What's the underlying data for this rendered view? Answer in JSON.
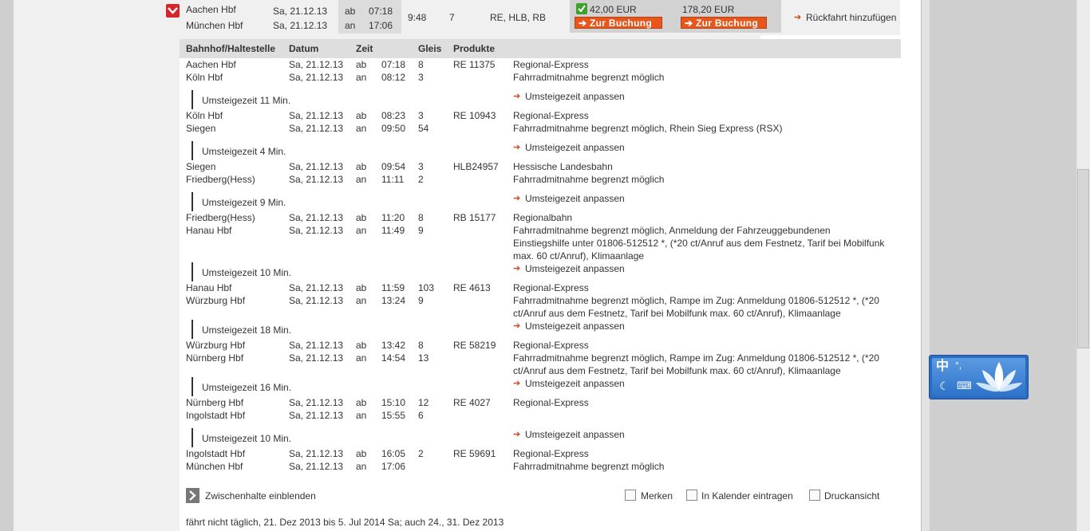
{
  "summary": {
    "from_station": "Aachen Hbf",
    "to_station": "München Hbf",
    "dep_date": "Sa, 21.12.13",
    "arr_date": "Sa, 21.12.13",
    "dep_label": "ab",
    "arr_label": "an",
    "dep_time": "07:18",
    "arr_time": "17:06",
    "duration": "9:48",
    "changes": "7",
    "products": "RE, HLB, RB",
    "price1": "42,00 EUR",
    "price2": "178,20 EUR",
    "booking_label": "Zur Buchung",
    "return_label": "Rückfahrt hinzufügen"
  },
  "columns": {
    "station": "Bahnhof/Haltestelle",
    "date": "Datum",
    "time": "Zeit",
    "platform": "Gleis",
    "products": "Produkte"
  },
  "legs": [
    {
      "dep_station": "Aachen Hbf",
      "dep_date": "Sa, 21.12.13",
      "dep_time": "07:18",
      "dep_platform": "8",
      "arr_station": "Köln Hbf",
      "arr_date": "Sa, 21.12.13",
      "arr_time": "08:12",
      "arr_platform": "3",
      "train": "RE 11375",
      "info1": "Regional-Express",
      "info_lines": [
        "Fahrradmitnahme begrenzt möglich"
      ]
    },
    {
      "dep_station": "Köln Hbf",
      "dep_date": "Sa, 21.12.13",
      "dep_time": "08:23",
      "dep_platform": "3",
      "arr_station": "Siegen",
      "arr_date": "Sa, 21.12.13",
      "arr_time": "09:50",
      "arr_platform": "54",
      "train": "RE 10943",
      "info1": "Regional-Express",
      "info_lines": [
        "Fahrradmitnahme begrenzt möglich, Rhein Sieg Express (RSX)"
      ]
    },
    {
      "dep_station": "Siegen",
      "dep_date": "Sa, 21.12.13",
      "dep_time": "09:54",
      "dep_platform": "3",
      "arr_station": "Friedberg(Hess)",
      "arr_date": "Sa, 21.12.13",
      "arr_time": "11:11",
      "arr_platform": "2",
      "train": "HLB24957",
      "info1": "Hessische Landesbahn",
      "info_lines": [
        "Fahrradmitnahme begrenzt möglich"
      ]
    },
    {
      "dep_station": "Friedberg(Hess)",
      "dep_date": "Sa, 21.12.13",
      "dep_time": "11:20",
      "dep_platform": "8",
      "arr_station": "Hanau Hbf",
      "arr_date": "Sa, 21.12.13",
      "arr_time": "11:49",
      "arr_platform": "9",
      "train": "RB 15177",
      "info1": "Regionalbahn",
      "info_lines": [
        "Fahrradmitnahme begrenzt möglich, Anmeldung der Fahrzeuggebundenen",
        "Einstiegshilfe unter 01806-512512 *, (*20 ct/Anruf aus dem Festnetz, Tarif bei Mobilfunk",
        "max. 60 ct/Anruf), Klimaanlage"
      ]
    },
    {
      "dep_station": "Hanau Hbf",
      "dep_date": "Sa, 21.12.13",
      "dep_time": "11:59",
      "dep_platform": "103",
      "arr_station": "Würzburg Hbf",
      "arr_date": "Sa, 21.12.13",
      "arr_time": "13:24",
      "arr_platform": "9",
      "train": "RE 4613",
      "info1": "Regional-Express",
      "info_lines": [
        "Fahrradmitnahme begrenzt möglich, Rampe im Zug: Anmeldung 01806-512512 *, (*20",
        "ct/Anruf aus dem Festnetz, Tarif bei Mobilfunk max. 60 ct/Anruf), Klimaanlage"
      ]
    },
    {
      "dep_station": "Würzburg Hbf",
      "dep_date": "Sa, 21.12.13",
      "dep_time": "13:42",
      "dep_platform": "8",
      "arr_station": "Nürnberg Hbf",
      "arr_date": "Sa, 21.12.13",
      "arr_time": "14:54",
      "arr_platform": "13",
      "train": "RE 58219",
      "info1": "Regional-Express",
      "info_lines": [
        "Fahrradmitnahme begrenzt möglich, Rampe im Zug: Anmeldung 01806-512512 *, (*20",
        "ct/Anruf aus dem Festnetz, Tarif bei Mobilfunk max. 60 ct/Anruf), Klimaanlage"
      ]
    },
    {
      "dep_station": "Nürnberg Hbf",
      "dep_date": "Sa, 21.12.13",
      "dep_time": "15:10",
      "dep_platform": "12",
      "arr_station": "Ingolstadt Hbf",
      "arr_date": "Sa, 21.12.13",
      "arr_time": "15:55",
      "arr_platform": "6",
      "train": "RE 4027",
      "info1": "Regional-Express",
      "info_lines": []
    },
    {
      "dep_station": "Ingolstadt Hbf",
      "dep_date": "Sa, 21.12.13",
      "dep_time": "16:05",
      "dep_platform": "2",
      "arr_station": "München Hbf",
      "arr_date": "Sa, 21.12.13",
      "arr_time": "17:06",
      "arr_platform": "",
      "train": "RE 59691",
      "info1": "Regional-Express",
      "info_lines": [
        "Fahrradmitnahme begrenzt möglich"
      ]
    }
  ],
  "transfers": [
    "Umsteigezeit 11 Min.",
    "Umsteigezeit 4 Min.",
    "Umsteigezeit 9 Min.",
    "Umsteigezeit 10 Min.",
    "Umsteigezeit 18 Min.",
    "Umsteigezeit 16 Min.",
    "Umsteigezeit 10 Min."
  ],
  "adjust_label": "Umsteigezeit anpassen",
  "dep_abbr": "ab",
  "arr_abbr": "an",
  "footer": {
    "show_stops": "Zwischenhalte einblenden",
    "remember": "Merken",
    "calendar": "In Kalender eintragen",
    "print": "Druckansicht",
    "note": "fährt nicht täglich, 21. Dez 2013 bis 5. Jul 2014 Sa; auch 24., 31. Dez 2013"
  },
  "ime": {
    "char": "中",
    "punct": "°,"
  },
  "colors": {
    "accent": "#d7262b",
    "booking": "#e8561b",
    "check": "#3f9e2c",
    "ime": "#2e73c9"
  }
}
